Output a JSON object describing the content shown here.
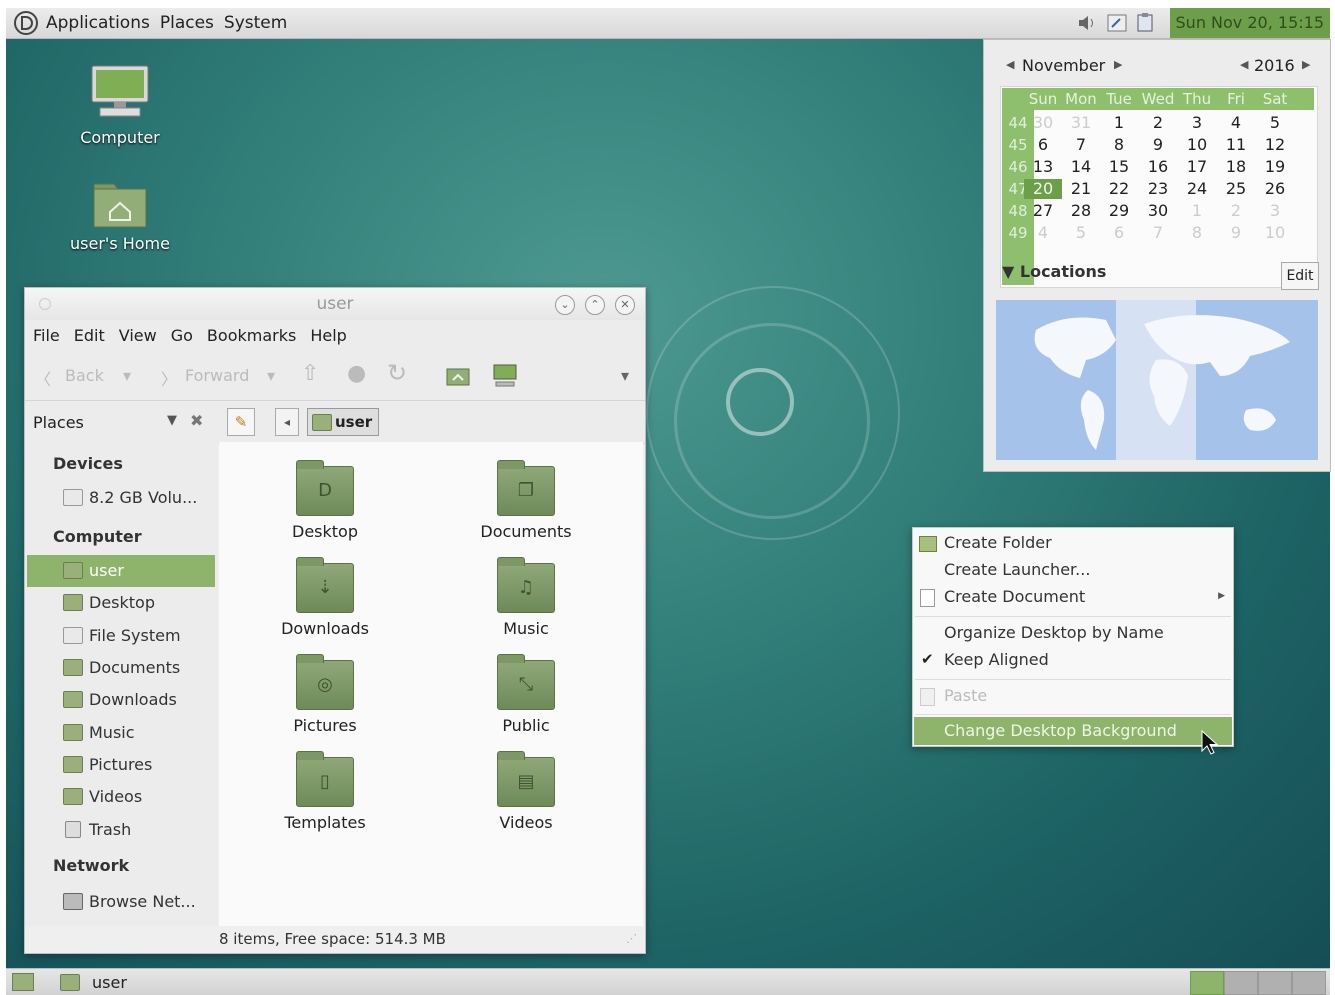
{
  "top_panel": {
    "menus": [
      "Applications",
      "Places",
      "System"
    ],
    "clock": "Sun Nov 20, 15:15",
    "tray_icons": [
      "volume-icon",
      "network-icon",
      "clipboard-icon"
    ]
  },
  "desktop_icons": [
    {
      "label": "Computer",
      "icon": "computer-icon"
    },
    {
      "label": "user's Home",
      "icon": "home-folder-icon"
    }
  ],
  "file_manager": {
    "title": "user",
    "menu": [
      "File",
      "Edit",
      "View",
      "Go",
      "Bookmarks",
      "Help"
    ],
    "toolbar": {
      "back": "Back",
      "forward": "Forward"
    },
    "side_pane_label": "Places",
    "location": "user",
    "sidebar": {
      "devices_header": "Devices",
      "devices": [
        "8.2 GB Volu..."
      ],
      "computer_header": "Computer",
      "computer_items": [
        "user",
        "Desktop",
        "File System",
        "Documents",
        "Downloads",
        "Music",
        "Pictures",
        "Videos",
        "Trash"
      ],
      "network_header": "Network",
      "network_items": [
        "Browse Net..."
      ]
    },
    "files": [
      {
        "name": "Desktop",
        "glyph": "D"
      },
      {
        "name": "Documents",
        "glyph": "❐"
      },
      {
        "name": "Downloads",
        "glyph": "⇣"
      },
      {
        "name": "Music",
        "glyph": "♫"
      },
      {
        "name": "Pictures",
        "glyph": "◎"
      },
      {
        "name": "Public",
        "glyph": "⤡"
      },
      {
        "name": "Templates",
        "glyph": "▯"
      },
      {
        "name": "Videos",
        "glyph": "▤"
      }
    ],
    "status": "8 items, Free space: 514.3 MB"
  },
  "calendar": {
    "month": "November",
    "year": "2016",
    "day_headers": [
      "Sun",
      "Mon",
      "Tue",
      "Wed",
      "Thu",
      "Fri",
      "Sat"
    ],
    "week_numbers": [
      "44",
      "45",
      "46",
      "47",
      "48",
      "49"
    ],
    "weeks": [
      [
        "30",
        "31",
        "1",
        "2",
        "3",
        "4",
        "5"
      ],
      [
        "6",
        "7",
        "8",
        "9",
        "10",
        "11",
        "12"
      ],
      [
        "13",
        "14",
        "15",
        "16",
        "17",
        "18",
        "19"
      ],
      [
        "20",
        "21",
        "22",
        "23",
        "24",
        "25",
        "26"
      ],
      [
        "27",
        "28",
        "29",
        "30",
        "1",
        "2",
        "3"
      ],
      [
        "4",
        "5",
        "6",
        "7",
        "8",
        "9",
        "10"
      ]
    ],
    "selected_day": "20",
    "locations_label": "Locations",
    "edit_label": "Edit"
  },
  "context_menu": {
    "items": [
      "Create Folder",
      "Create Launcher...",
      "Create Document",
      "Organize Desktop by Name",
      "Keep Aligned",
      "Paste",
      "Change Desktop Background"
    ],
    "highlighted": "Change Desktop Background"
  },
  "bottom_panel": {
    "task": "user"
  },
  "colors": {
    "accent": "#8db46a",
    "desktop": "#2f7a77",
    "clock_bg": "#6d9f4a"
  }
}
